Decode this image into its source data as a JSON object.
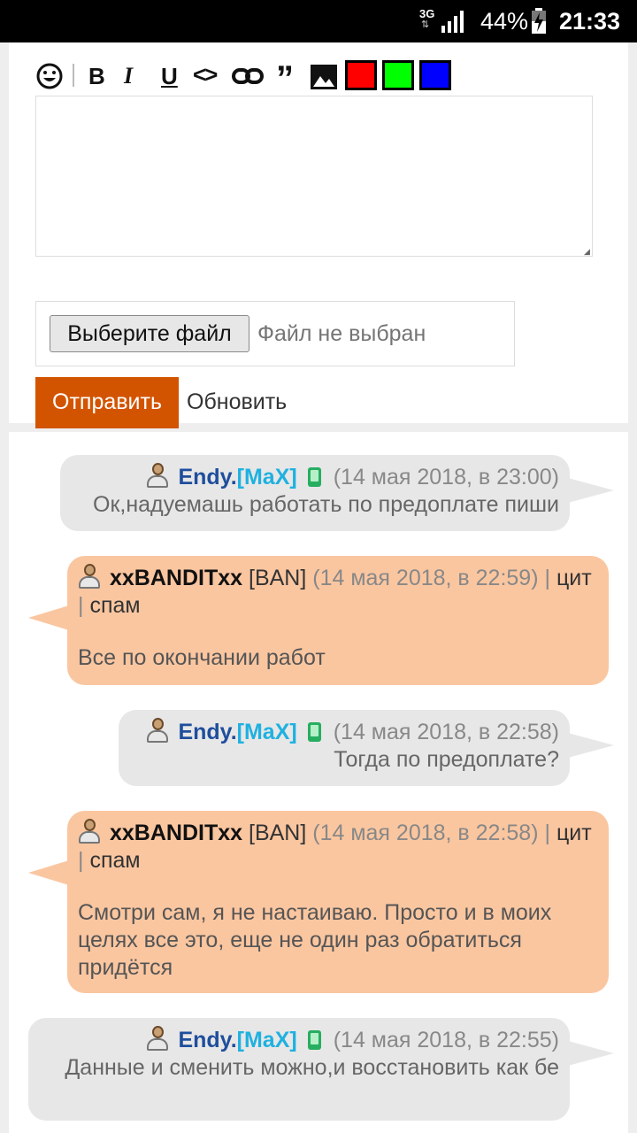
{
  "status_bar": {
    "network": "3G",
    "battery": "44%",
    "time": "21:33"
  },
  "editor": {
    "toolbar": {
      "smiley_icon": "smiley-icon",
      "bold": "B",
      "italic": "I",
      "underline": "U",
      "code": "<>",
      "link_icon": "link-icon",
      "quote": "”",
      "image_icon": "image-icon",
      "colors": [
        "#ff0000",
        "#00ff00",
        "#0000ff"
      ]
    },
    "message_value": ""
  },
  "file": {
    "button_label": "Выберите файл",
    "status": "Файл не выбран"
  },
  "actions": {
    "send_label": "Отправить",
    "refresh_label": "Обновить"
  },
  "messages": [
    {
      "nick_part1": "Endy.",
      "nick_part2": "[MaX]",
      "time": "(14 мая 2018, в 23:00)",
      "text": "Ок,надуемашь работать по предоплате пиши"
    },
    {
      "nick": "xxBANDITxx",
      "rank": "[BAN]",
      "time": "(14 мая 2018, в 22:59)",
      "sep1": "|",
      "quote_label": "цит",
      "sep2": "|",
      "spam_label": "спам",
      "text": "Все по окончании работ"
    },
    {
      "nick_part1": "Endy.",
      "nick_part2": "[MaX]",
      "time": "(14 мая 2018, в 22:58)",
      "text": "Тогда по предоплате?"
    },
    {
      "nick": "xxBANDITxx",
      "rank": "[BAN]",
      "time": "(14 мая 2018, в 22:58)",
      "sep1": "|",
      "quote_label": "цит",
      "sep2": "|",
      "spam_label": "спам",
      "text": "Смотри сам, я не настаиваю. Просто и в моих целях все это, еще не один раз обратиться придётся"
    },
    {
      "nick_part1": "Endy.",
      "nick_part2": "[MaX]",
      "time": "(14 мая 2018, в 22:55)",
      "text": "Данные и сменить можно,и восстановить как бе"
    }
  ]
}
